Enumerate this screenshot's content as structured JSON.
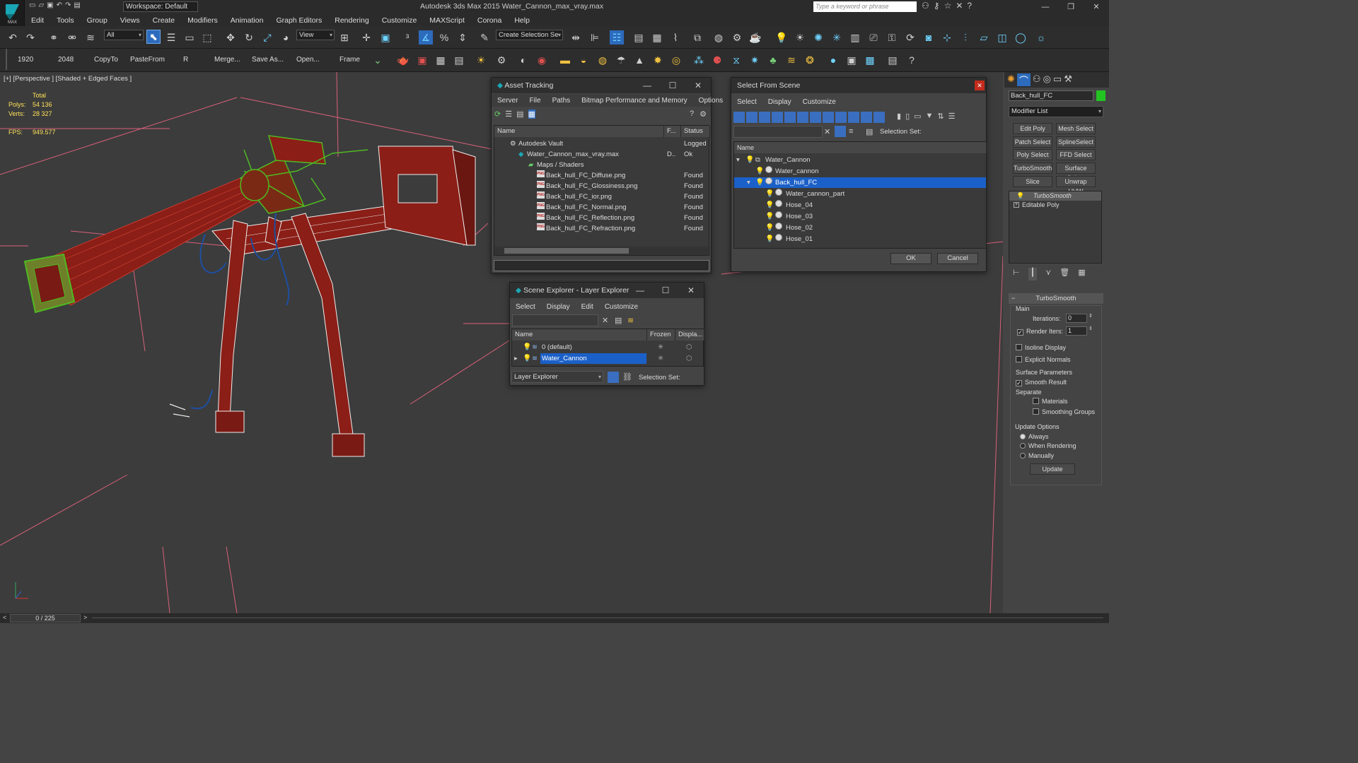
{
  "app": {
    "title": "Autodesk 3ds Max  2015    Water_Cannon_max_vray.max",
    "workspace": "Workspace: Default",
    "search_placeholder": "Type a keyword or phrase",
    "logo": "MAX"
  },
  "menu": [
    "Edit",
    "Tools",
    "Group",
    "Views",
    "Create",
    "Modifiers",
    "Animation",
    "Graph Editors",
    "Rendering",
    "Customize",
    "MAXScript",
    "Corona",
    "Help"
  ],
  "toolbar1": {
    "filter": "All",
    "ref_coord": "View",
    "selection_set": "Create Selection Se"
  },
  "toolbar2": [
    "1920",
    "2048",
    "CopyTo",
    "PasteFrom",
    "R",
    "Merge...",
    "Save As...",
    "Open...",
    "Frame"
  ],
  "viewport": {
    "label": "[+] [Perspective ] [Shaded + Edged Faces ]",
    "total_label": "Total",
    "polys_label": "Polys:",
    "polys": "54 136",
    "verts_label": "Verts:",
    "verts": "28 327",
    "fps_label": "FPS:",
    "fps": "949.577"
  },
  "asset_tracking": {
    "title": "Asset Tracking",
    "menu": [
      "Server",
      "File",
      "Paths",
      "Bitmap Performance and Memory",
      "Options"
    ],
    "headers": [
      "Name",
      "F...",
      "Status"
    ],
    "rows": [
      {
        "name": "Autodesk Vault",
        "f": "",
        "status": "Logged"
      },
      {
        "name": "Water_Cannon_max_vray.max",
        "f": "D..",
        "status": "Ok"
      },
      {
        "name": "Maps / Shaders",
        "f": "",
        "status": ""
      },
      {
        "name": "Back_hull_FC_Diffuse.png",
        "f": "",
        "status": "Found"
      },
      {
        "name": "Back_hull_FC_Glossiness.png",
        "f": "",
        "status": "Found"
      },
      {
        "name": "Back_hull_FC_ior.png",
        "f": "",
        "status": "Found"
      },
      {
        "name": "Back_hull_FC_Normal.png",
        "f": "",
        "status": "Found"
      },
      {
        "name": "Back_hull_FC_Reflection.png",
        "f": "",
        "status": "Found"
      },
      {
        "name": "Back_hull_FC_Refraction.png",
        "f": "",
        "status": "Found"
      }
    ]
  },
  "select_from_scene": {
    "title": "Select From Scene",
    "menu": [
      "Select",
      "Display",
      "Customize"
    ],
    "selection_set_label": "Selection Set:",
    "col_name": "Name",
    "rows": [
      {
        "name": "Water_Cannon",
        "level": 0
      },
      {
        "name": "Water_cannon",
        "level": 1
      },
      {
        "name": "Back_hull_FC",
        "level": 1
      },
      {
        "name": "Water_cannon_part",
        "level": 2
      },
      {
        "name": "Hose_04",
        "level": 2
      },
      {
        "name": "Hose_03",
        "level": 2
      },
      {
        "name": "Hose_02",
        "level": 2
      },
      {
        "name": "Hose_01",
        "level": 2
      }
    ],
    "ok": "OK",
    "cancel": "Cancel"
  },
  "scene_explorer": {
    "title": "Scene Explorer - Layer Explorer",
    "menu": [
      "Select",
      "Display",
      "Edit",
      "Customize"
    ],
    "headers": [
      "Name",
      "Frozen",
      "Displa..."
    ],
    "rows": [
      {
        "name": "0 (default)"
      },
      {
        "name": "Water_Cannon"
      }
    ],
    "footer_dropdown": "Layer Explorer",
    "selection_set_label": "Selection Set:"
  },
  "command_panel": {
    "object_name": "Back_hull_FC",
    "object_color": "#22c422",
    "modifier_list": "Modifier List",
    "buttons": [
      "Edit Poly",
      "Mesh Select",
      "Patch Select",
      "SplineSelect",
      "Poly Select",
      "FFD Select",
      "TurboSmooth",
      "Surface Select",
      "Slice",
      "Unwrap UVW"
    ],
    "stack": [
      "TurboSmooth",
      "Editable Poly"
    ],
    "rollout_title": "TurboSmooth",
    "main_label": "Main",
    "iterations_label": "Iterations:",
    "iterations": "0",
    "render_iters_label": "Render Iters:",
    "render_iters": "1",
    "isoline": "Isoline Display",
    "explicit_normals": "Explicit Normals",
    "surface_params": "Surface Parameters",
    "smooth_result": "Smooth Result",
    "separate": "Separate",
    "materials": "Materials",
    "smoothing_groups": "Smoothing Groups",
    "update_options": "Update Options",
    "always": "Always",
    "when_rendering": "When Rendering",
    "manually": "Manually",
    "update": "Update"
  },
  "status": {
    "frame": "0 / 225"
  },
  "colors": {
    "accent": "#1b60c8",
    "mesh_red": "#8b1e16",
    "mesh_green": "#3fa01a",
    "mesh_blue": "#1e4ea0"
  }
}
